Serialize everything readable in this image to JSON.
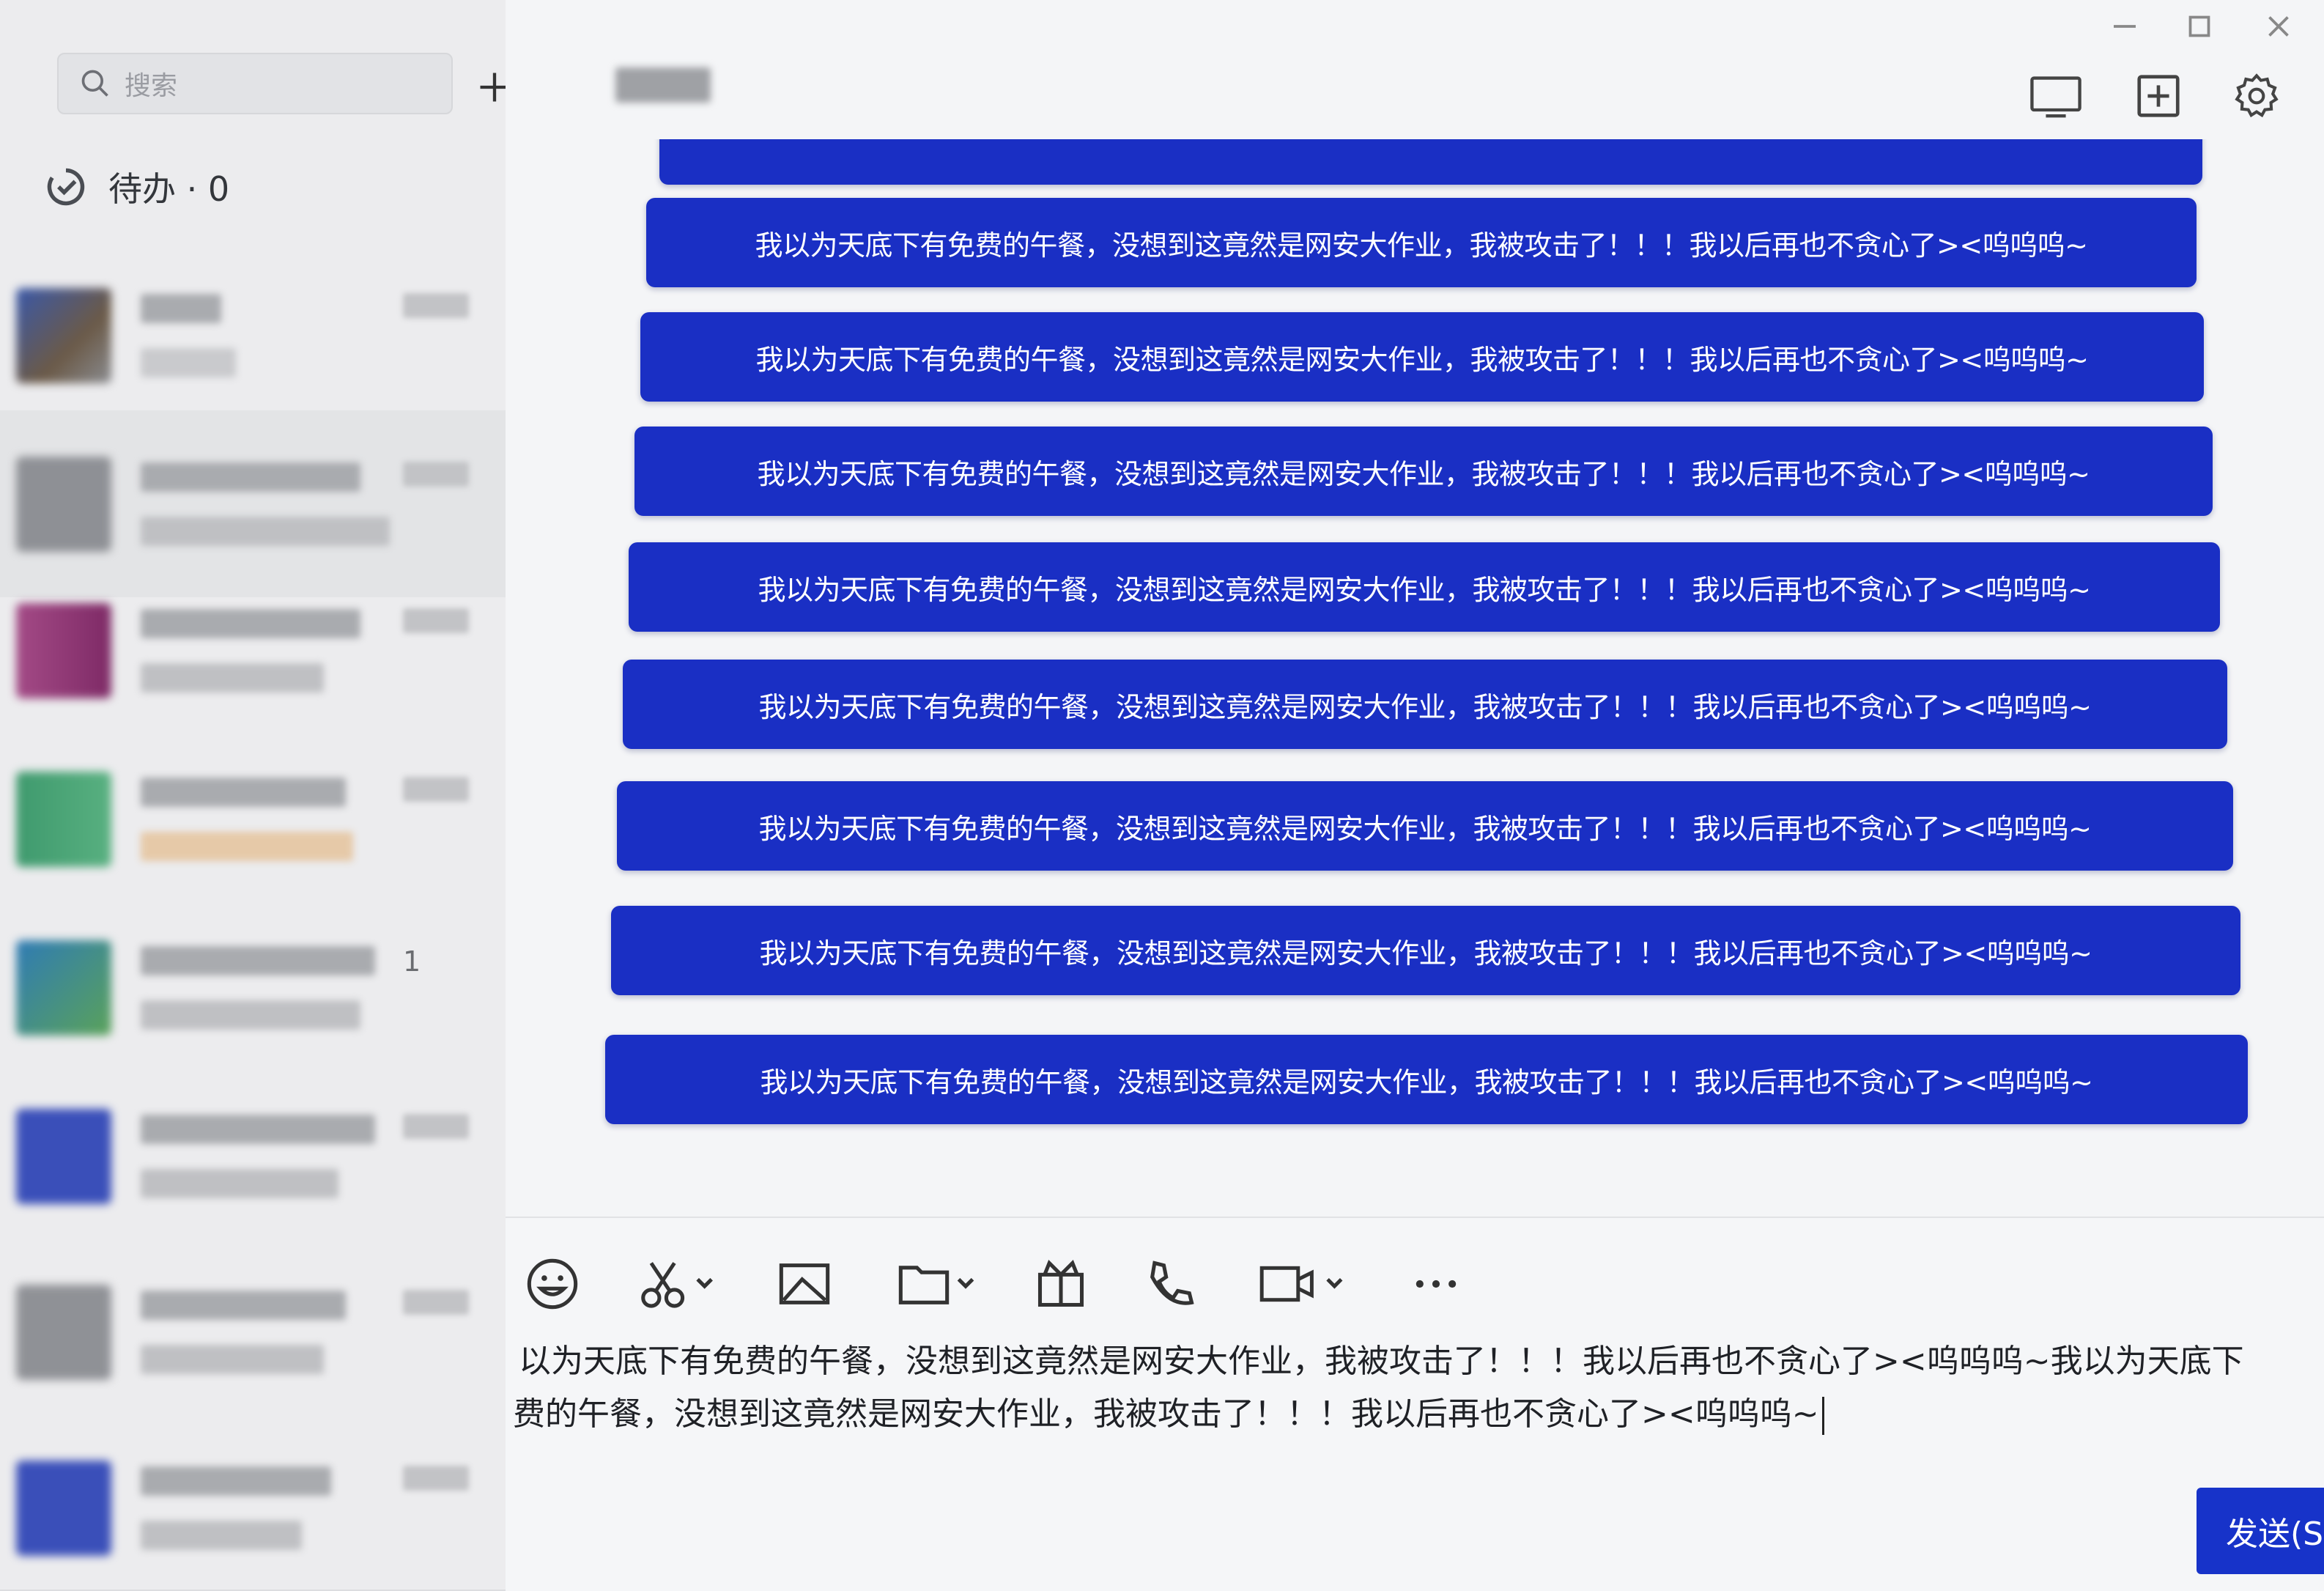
{
  "sidebar": {
    "search_placeholder": "搜索",
    "add_label": "+",
    "todo_label": "待办 · 0",
    "contacts": [
      {
        "avatar_color": "#3a58a8"
      },
      {
        "avatar_color": "#8e9095"
      },
      {
        "avatar_color": "#a34a86"
      },
      {
        "avatar_color": "#3f9a6e"
      },
      {
        "avatar_color": "#2f7bb4",
        "unread": "1"
      },
      {
        "avatar_color": "#3a4fb9"
      },
      {
        "avatar_color": "#8f9196"
      },
      {
        "avatar_color": "#3a4fb9"
      }
    ]
  },
  "chat": {
    "messages": [
      {
        "text": "我以为天底下有免费的午餐，没想到这竟然是网安大作业，我被攻击了！！！我以后再也不贪心了><呜呜呜~"
      },
      {
        "text": "我以为天底下有免费的午餐，没想到这竟然是网安大作业，我被攻击了！！！我以后再也不贪心了><呜呜呜~"
      },
      {
        "text": "我以为天底下有免费的午餐，没想到这竟然是网安大作业，我被攻击了！！！我以后再也不贪心了><呜呜呜~"
      },
      {
        "text": "我以为天底下有免费的午餐，没想到这竟然是网安大作业，我被攻击了！！！我以后再也不贪心了><呜呜呜~"
      },
      {
        "text": "我以为天底下有免费的午餐，没想到这竟然是网安大作业，我被攻击了！！！我以后再也不贪心了><呜呜呜~"
      },
      {
        "text": "我以为天底下有免费的午餐，没想到这竟然是网安大作业，我被攻击了！！！我以后再也不贪心了><呜呜呜~"
      },
      {
        "text": "我以为天底下有免费的午餐，没想到这竟然是网安大作业，我被攻击了！！！我以后再也不贪心了><呜呜呜~"
      },
      {
        "text": "我以为天底下有免费的午餐，没想到这竟然是网安大作业，我被攻击了！！！我以后再也不贪心了><呜呜呜~"
      }
    ],
    "bubble_color": "#1a2fc4",
    "toolbar_icons": [
      "emoji-icon",
      "scissors-icon",
      "image-icon",
      "folder-icon",
      "gift-box-icon",
      "phone-icon",
      "video-icon",
      "more-icon"
    ]
  },
  "composer": {
    "draft_line1": "以为天底下有免费的午餐，没想到这竟然是网安大作业，我被攻击了！！！我以后再也不贪心了><呜呜呜~我以为天底下",
    "draft_line2": "费的午餐，没想到这竟然是网安大作业，我被攻击了！！！我以后再也不贪心了><呜呜呜~",
    "send_label": "发送(S"
  },
  "window_controls": [
    "minimize-icon",
    "maximize-icon",
    "close-icon"
  ],
  "header_icons": [
    "screen-share-icon",
    "add-member-icon",
    "settings-icon"
  ]
}
